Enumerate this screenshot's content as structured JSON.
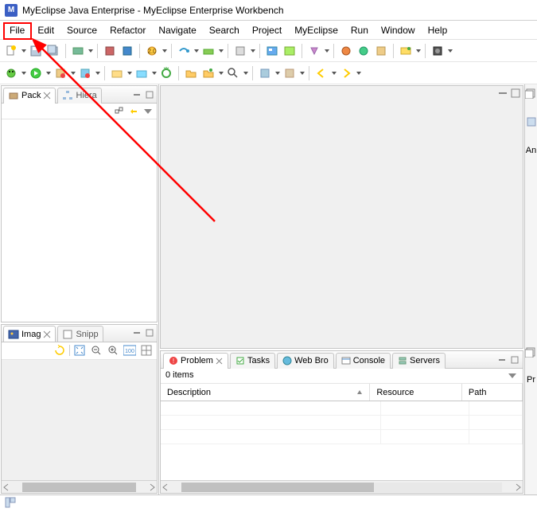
{
  "title": "MyEclipse Java Enterprise - MyEclipse Enterprise Workbench",
  "menu": {
    "file": "File",
    "edit": "Edit",
    "source": "Source",
    "refactor": "Refactor",
    "navigate": "Navigate",
    "search": "Search",
    "project": "Project",
    "myeclipse": "MyEclipse",
    "run": "Run",
    "window": "Window",
    "help": "Help"
  },
  "views": {
    "package": {
      "tab": "Pack",
      "tab2": "Hiera"
    },
    "image": {
      "tab": "Imag",
      "tab2": "Snipp"
    }
  },
  "bottom": {
    "tabs": {
      "problem": "Problem",
      "tasks": "Tasks",
      "webbro": "Web Bro",
      "console": "Console",
      "servers": "Servers"
    },
    "items": "0 items",
    "columns": {
      "description": "Description",
      "resource": "Resource",
      "path": "Path"
    }
  },
  "right": {
    "an": "An",
    "pr": "Pr"
  }
}
